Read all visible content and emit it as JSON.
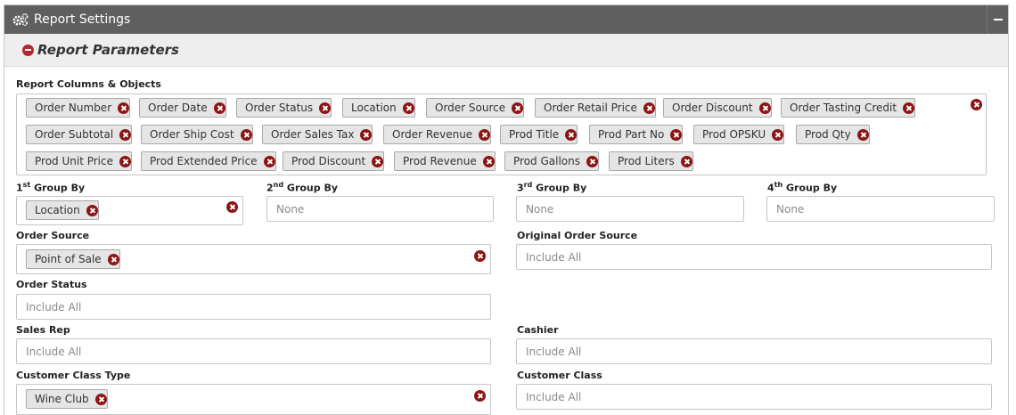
{
  "header": {
    "title": "Report Settings",
    "icon": "gears-icon"
  },
  "params": {
    "title": "Report Parameters"
  },
  "columns": {
    "label": "Report Columns & Objects",
    "tags": [
      "Order Number",
      "Order Date",
      "Order Status",
      "Location",
      "Order Source",
      "Order Retail Price",
      "Order Discount",
      "Order Tasting Credit",
      "Order Subtotal",
      "Order Ship Cost",
      "Order Sales Tax",
      "Order Revenue",
      "Prod Title",
      "Prod Part No",
      "Prod OPSKU",
      "Prod Qty",
      "Prod Unit Price",
      "Prod Extended Price",
      "Prod Discount",
      "Prod Revenue",
      "Prod Gallons",
      "Prod Liters"
    ]
  },
  "group1": {
    "num": "1",
    "suffix": "st",
    "label": "Group By",
    "tags": [
      "Location"
    ]
  },
  "group2": {
    "num": "2",
    "suffix": "nd",
    "label": "Group By",
    "placeholder": "None"
  },
  "group3": {
    "num": "3",
    "suffix": "rd",
    "label": "Group By",
    "placeholder": "None"
  },
  "group4": {
    "num": "4",
    "suffix": "th",
    "label": "Group By",
    "placeholder": "None"
  },
  "order_source": {
    "label": "Order Source",
    "tags": [
      "Point of Sale"
    ]
  },
  "original_order_source": {
    "label": "Original Order Source",
    "placeholder": "Include All"
  },
  "order_status": {
    "label": "Order Status",
    "placeholder": "Include All"
  },
  "sales_rep": {
    "label": "Sales Rep",
    "placeholder": "Include All"
  },
  "cashier": {
    "label": "Cashier",
    "placeholder": "Include All"
  },
  "customer_class_type": {
    "label": "Customer Class Type",
    "tags": [
      "Wine Club"
    ]
  },
  "customer_class": {
    "label": "Customer Class",
    "placeholder": "Include All"
  },
  "colors": {
    "header_bg": "#5f5f5f",
    "remove_icon": "#8c1414",
    "tag_bg": "#e5e5e5"
  }
}
